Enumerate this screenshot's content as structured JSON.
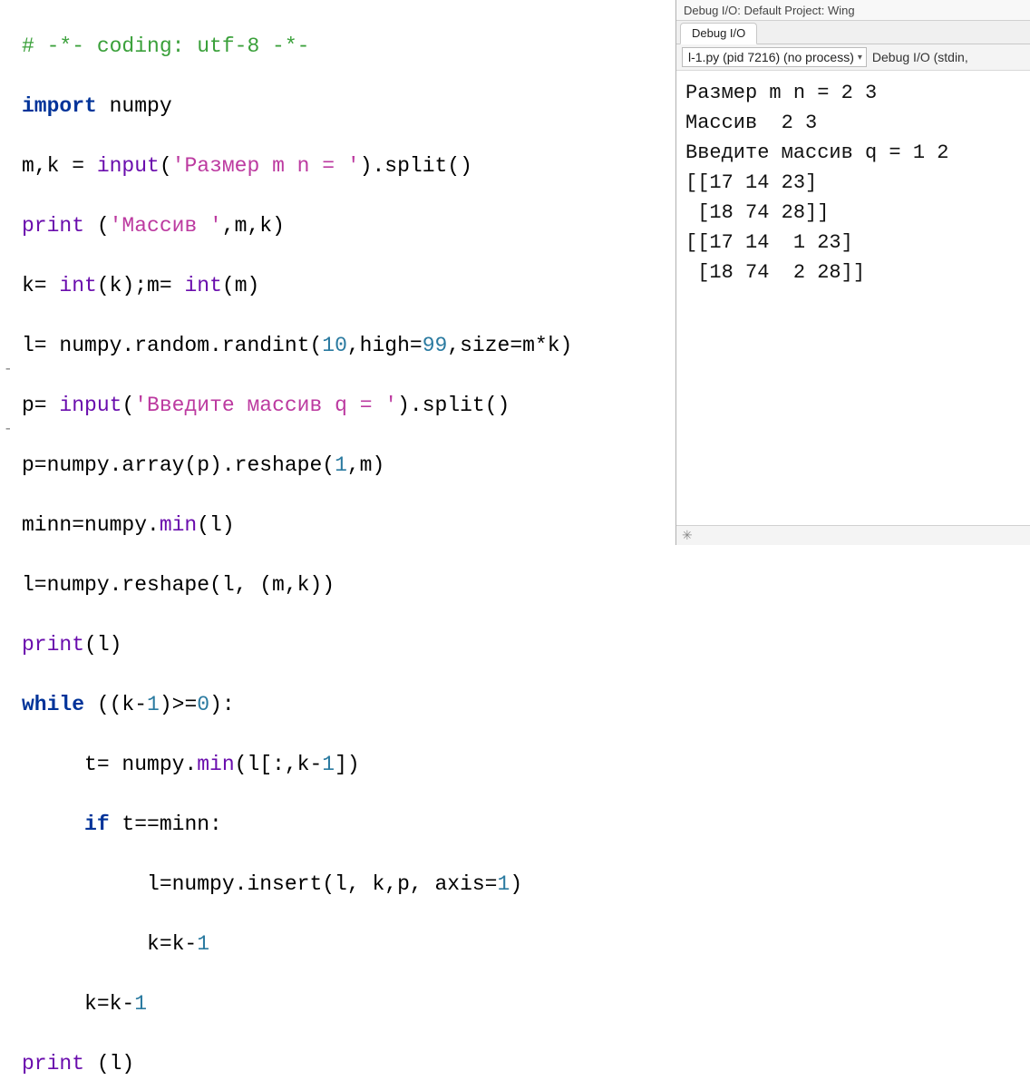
{
  "code": {
    "line1_comment": "# -*- coding: utf-8 -*-",
    "line2_kw": "import",
    "line2_mod": " numpy",
    "line3_a": "m,k = ",
    "line3_fn": "input",
    "line3_b": "(",
    "line3_str": "'Размер m n = '",
    "line3_c": ").split()",
    "line4_fn": "print",
    "line4_a": " (",
    "line4_str": "'Массив '",
    "line4_b": ",m,k)",
    "line5_a": "k= ",
    "line5_fn1": "int",
    "line5_b": "(k);m= ",
    "line5_fn2": "int",
    "line5_c": "(m)",
    "line6_a": "l= numpy.random.randint(",
    "line6_n1": "10",
    "line6_b": ",high=",
    "line6_n2": "99",
    "line6_c": ",size=m*k)",
    "line7_a": "p= ",
    "line7_fn": "input",
    "line7_b": "(",
    "line7_str": "'Введите массив q = '",
    "line7_c": ").split()",
    "line8_a": "p=numpy.array(p).reshape(",
    "line8_n1": "1",
    "line8_b": ",m)",
    "line9_a": "minn=numpy.",
    "line9_fn": "min",
    "line9_b": "(l)",
    "line10_a": "l=numpy.reshape(l, (m,k))",
    "line11_fn": "print",
    "line11_a": "(l)",
    "line12_kw": "while",
    "line12_a": " ((k-",
    "line12_n1": "1",
    "line12_b": ")>=",
    "line12_n2": "0",
    "line12_c": "):",
    "line13_a": "     t= numpy.",
    "line13_fn": "min",
    "line13_b": "(l[:,k-",
    "line13_n1": "1",
    "line13_c": "])",
    "line14_a": "     ",
    "line14_kw": "if",
    "line14_b": " t==minn:",
    "line15_a": "          l=numpy.insert(l, k,p, axis=",
    "line15_n1": "1",
    "line15_b": ")",
    "line16_a": "          k=k-",
    "line16_n1": "1",
    "line17_a": "     k=k-",
    "line17_n1": "1",
    "line18_fn": "print",
    "line18_a": " (l)"
  },
  "debug": {
    "title": "Debug I/O: Default Project: Wing",
    "tab": "Debug I/O",
    "process": "l-1.py (pid 7216) (no process)",
    "toolbar_label": "Debug I/O (stdin,",
    "output": "Размер m n = 2 3\nМассив  2 3\nВведите массив q = 1 2\n[[17 14 23]\n [18 74 28]]\n[[17 14  1 23]\n [18 74  2 28]]"
  },
  "icons": {
    "fold1": "-",
    "fold2": "-",
    "chev": "▾",
    "bug": "✳"
  }
}
